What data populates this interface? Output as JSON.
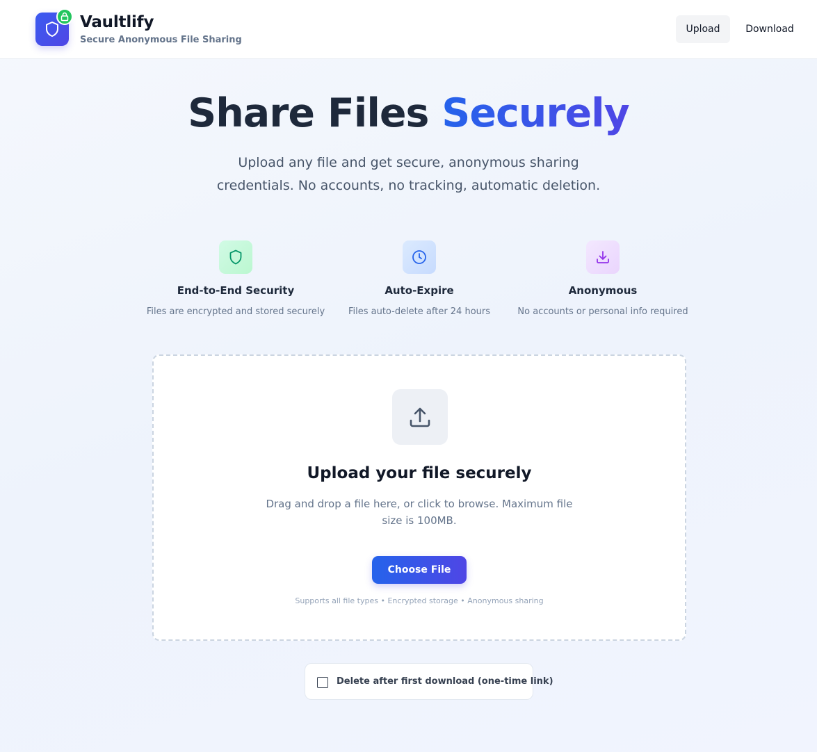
{
  "header": {
    "brand_name": "Vaultlify",
    "brand_tagline": "Secure Anonymous File Sharing",
    "nav": {
      "upload_label": "Upload",
      "download_label": "Download"
    },
    "logo_icon": "shield-icon",
    "badge_icon": "lock-icon"
  },
  "hero": {
    "title_plain": "Share Files ",
    "title_accent": "Securely",
    "subtitle": "Upload any file and get secure, anonymous sharing credentials. No accounts, no tracking, automatic deletion."
  },
  "features": [
    {
      "icon": "shield-icon",
      "title": "End-to-End Security",
      "description": "Files are encrypted and stored securely",
      "color": "#059669"
    },
    {
      "icon": "clock-icon",
      "title": "Auto-Expire",
      "description": "Files auto-delete after 24 hours",
      "color": "#2563eb"
    },
    {
      "icon": "download-icon",
      "title": "Anonymous",
      "description": "No accounts or personal info required",
      "color": "#9333ea"
    }
  ],
  "upload": {
    "icon": "upload-icon",
    "title": "Upload your file securely",
    "description": "Drag and drop a file here, or click to browse. Maximum file size is 100MB.",
    "button_label": "Choose File",
    "footnote": "Supports all file types • Encrypted storage • Anonymous sharing"
  },
  "options": {
    "delete_after_download": {
      "label": "Delete after first download (one-time link)",
      "checked": false
    }
  },
  "colors": {
    "accent": "#4f46e5",
    "accent_blue": "#2563eb",
    "badge_green": "#22c55e"
  }
}
